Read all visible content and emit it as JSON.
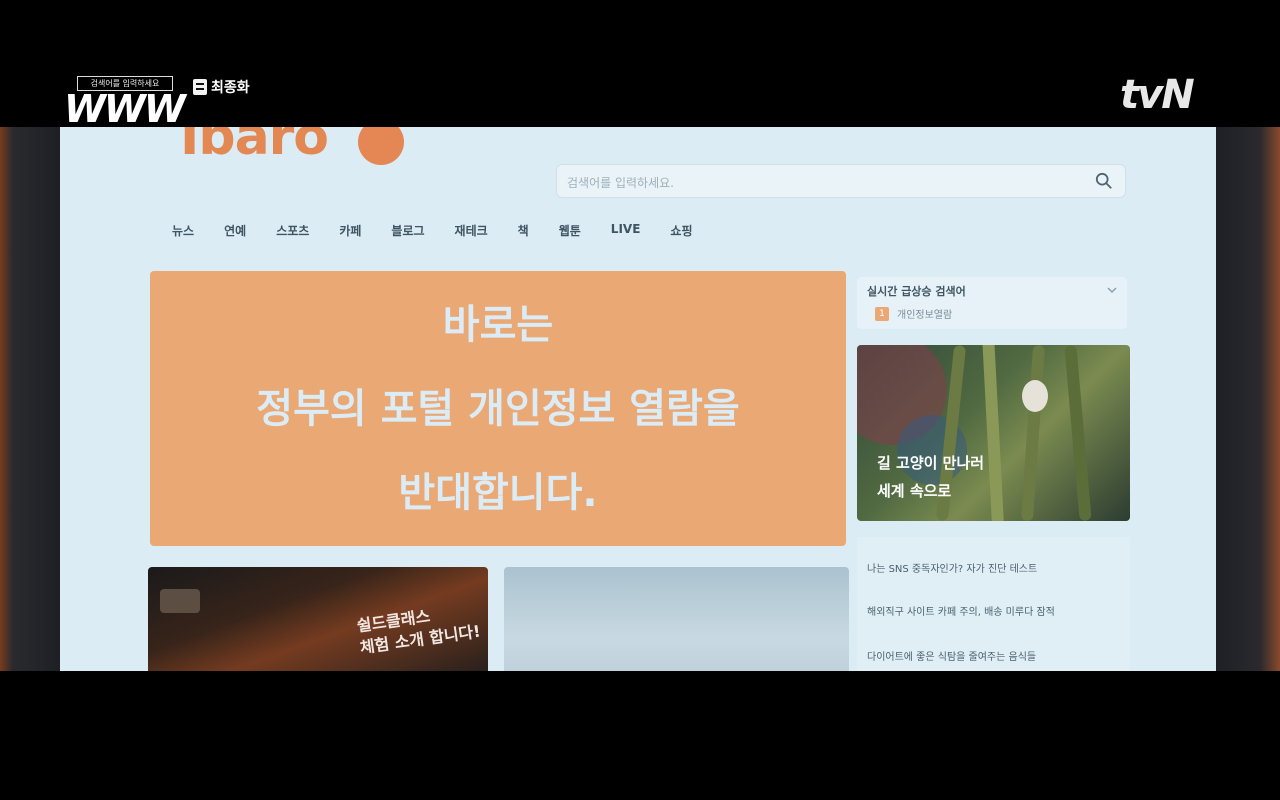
{
  "overlay": {
    "show_tagline": "검색어를 입력하세요",
    "show_logo": "WWW",
    "episode_label": "최종화",
    "network_logo": "tvN"
  },
  "site": {
    "logo": "Ibaro",
    "search": {
      "placeholder": "검색어를 입력하세요."
    },
    "nav": [
      "뉴스",
      "연예",
      "스포츠",
      "카페",
      "블로그",
      "재테크",
      "책",
      "웹툰",
      "LIVE",
      "쇼핑"
    ],
    "banner": {
      "lines": [
        "바로는",
        "정부의 포털 개인정보 열람을",
        "반대합니다."
      ]
    },
    "trending": {
      "title": "실시간 급상승 검색어",
      "items": [
        {
          "rank": "1",
          "text": "개인정보열람"
        }
      ]
    },
    "photo_card": {
      "caption": [
        "길 고양이 만나러",
        "세계 속으로"
      ]
    },
    "list": [
      "나는 SNS 중독자인가? 자가 진단 테스트",
      "해외직구 사이트 카페 주의, 배송 미루다 잠적",
      "다이어트에 좋은 식탐을 줄여주는 음식들"
    ],
    "game_card": {
      "text": [
        "쉴드클래스",
        "체험 소개 합니다!"
      ]
    }
  },
  "colors": {
    "banner_bg": "#f0a76d",
    "banner_text": "#d9ecf8",
    "screen_bg": "#d9ecf6",
    "brand": "#ef7a3a"
  }
}
